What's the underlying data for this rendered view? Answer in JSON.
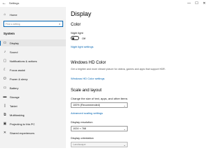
{
  "window": {
    "title": "Settings",
    "controls": {
      "minimize": "—",
      "maximize": "☐",
      "close": "✕"
    }
  },
  "sidebar": {
    "home_label": "Home",
    "search_placeholder": "Find a setting",
    "section_title": "System",
    "items": [
      {
        "label": "Display",
        "icon": "monitor-icon",
        "glyph": "▭",
        "selected": true
      },
      {
        "label": "Sound",
        "icon": "speaker-icon",
        "glyph": "♪",
        "selected": false
      },
      {
        "label": "Notifications & actions",
        "icon": "notification-icon",
        "glyph": "▢",
        "selected": false
      },
      {
        "label": "Focus assist",
        "icon": "moon-icon",
        "glyph": "☾",
        "selected": false
      },
      {
        "label": "Power & sleep",
        "icon": "power-icon",
        "glyph": "⏻",
        "selected": false
      },
      {
        "label": "Battery",
        "icon": "battery-icon",
        "glyph": "▭",
        "selected": false
      },
      {
        "label": "Storage",
        "icon": "storage-icon",
        "glyph": "▬",
        "selected": false
      },
      {
        "label": "Tablet",
        "icon": "tablet-icon",
        "glyph": "▯",
        "selected": false
      },
      {
        "label": "Multitasking",
        "icon": "multitasking-icon",
        "glyph": "⧉",
        "selected": false
      },
      {
        "label": "Projecting to this PC",
        "icon": "projecting-icon",
        "glyph": "▣",
        "selected": false
      },
      {
        "label": "Shared experiences",
        "icon": "shared-icon",
        "glyph": "✕",
        "selected": false
      }
    ]
  },
  "main": {
    "title": "Display",
    "color_heading": "Color",
    "night_light_label": "Night light",
    "night_light_state": "Off",
    "night_light_link": "Night light settings",
    "hd_heading": "Windows HD Color",
    "hd_description": "Get a brighter and more vibrant picture for videos, games and apps that support HDR.",
    "hd_link": "Windows HD Color settings",
    "scale_heading": "Scale and layout",
    "scale_label": "Change the size of text, apps, and other items",
    "scale_value": "100% (Recommended)",
    "advanced_link": "Advanced scaling settings",
    "resolution_label": "Display resolution",
    "resolution_value": "1024 × 768",
    "orientation_label": "Display orientation",
    "orientation_value": "Landscape"
  },
  "colors": {
    "accent": "#0063b1",
    "sidebar_bg": "#f2f2f2"
  }
}
